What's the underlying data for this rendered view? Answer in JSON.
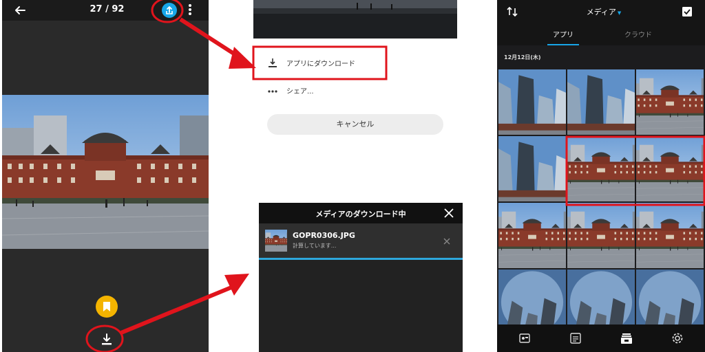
{
  "viewer": {
    "counter": "27 / 92",
    "icons": {
      "back": "arrow-left-icon",
      "share": "share-icon",
      "more": "more-vertical-icon",
      "highlight": "hilight-tag-icon",
      "download": "download-icon"
    }
  },
  "share_sheet": {
    "download_label": "アプリにダウンロード",
    "share_label": "シェア...",
    "cancel_label": "キャンセル"
  },
  "download_dialog": {
    "title": "メディアのダウンロード中",
    "file_name": "GOPR0306.JPG",
    "status": "計算しています...",
    "progress": 1.0
  },
  "gallery": {
    "title": "メディア",
    "tabs": [
      "アプリ",
      "クラウド"
    ],
    "active_tab": "アプリ",
    "date": "12月12日(木)",
    "cells": [
      "tower",
      "tower",
      "station",
      "tower",
      "station",
      "station",
      "station",
      "station",
      "station",
      "sky",
      "sky",
      "sky"
    ],
    "selected_cells": [
      4,
      5
    ],
    "icons": {
      "sort": "sort-icon",
      "select": "select-check-icon",
      "nav": [
        "camera-icon",
        "list-icon",
        "media-icon",
        "settings-icon"
      ]
    }
  },
  "colors": {
    "accent": "#17a6e8",
    "annotation": "#e0141c",
    "highlight": "#f4b400"
  }
}
